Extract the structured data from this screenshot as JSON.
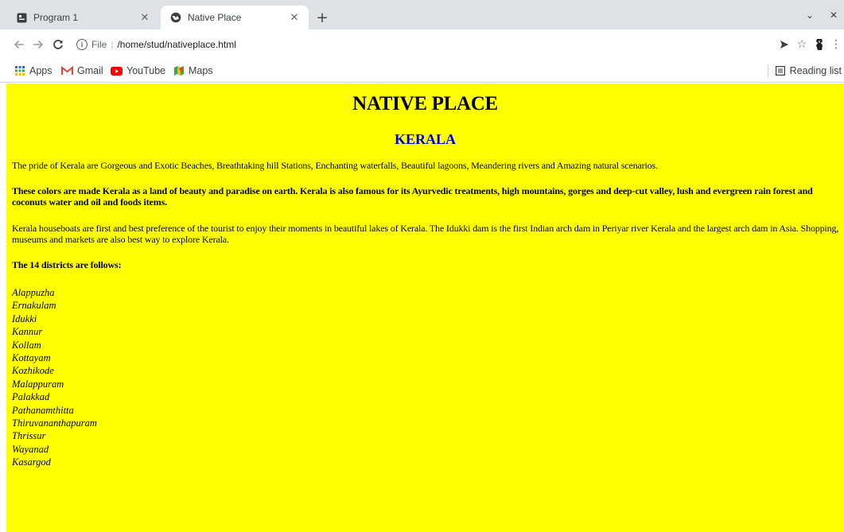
{
  "browser": {
    "tabs": [
      {
        "title": "Program 1",
        "icon": "page-icon",
        "active": false
      },
      {
        "title": "Native Place",
        "icon": "globe-icon",
        "active": true
      }
    ],
    "new_tab_label": "+",
    "address": {
      "scheme": "File",
      "separator": "|",
      "path": "/home/stud/nativeplace.html"
    },
    "bookmarks": [
      {
        "label": "Apps",
        "icon": "apps-grid-icon"
      },
      {
        "label": "Gmail",
        "icon": "gmail-icon"
      },
      {
        "label": "YouTube",
        "icon": "youtube-icon"
      },
      {
        "label": "Maps",
        "icon": "maps-icon"
      }
    ],
    "reading_list": "Reading list"
  },
  "page": {
    "background": "#ffff00",
    "heading": "NATIVE PLACE",
    "subheading": "KERALA",
    "subheading_color": "#0000cc",
    "paragraph1": "The pride of Kerala are Gorgeous and Exotic Beaches, Breathtaking hill Stations, Enchanting waterfalls, Beautiful lagoons, Meandering rivers and Amazing natural scenarios.",
    "paragraph2": "These colors are made Kerala as a land of beauty and paradise on earth. Kerala is also famous for its Ayurvedic treatments, high mountains, gorges and deep-cut valley, lush and evergreen rain forest and coconuts water and oil and foods items.",
    "paragraph3": "Kerala houseboats are first and best preference of the tourist to enjoy their moments in beautiful lakes of Kerala. The Idukki dam is the first Indian arch dam in Periyar river Kerala and the largest arch dam in Asia. Shopping, museums and markets are also best way to explore Kerala.",
    "districts_heading": "The 14 districts are follows:",
    "districts": [
      "Alappuzha",
      "Ernakulam",
      "Idukki",
      "Kannur",
      "Kollam",
      "Kottayam",
      "Kozhikode",
      "Malappuram",
      "Palakkad",
      "Pathanamthitta",
      "Thiruvananthapuram",
      "Thrissur",
      "Wayanad",
      "Kasargod"
    ]
  }
}
